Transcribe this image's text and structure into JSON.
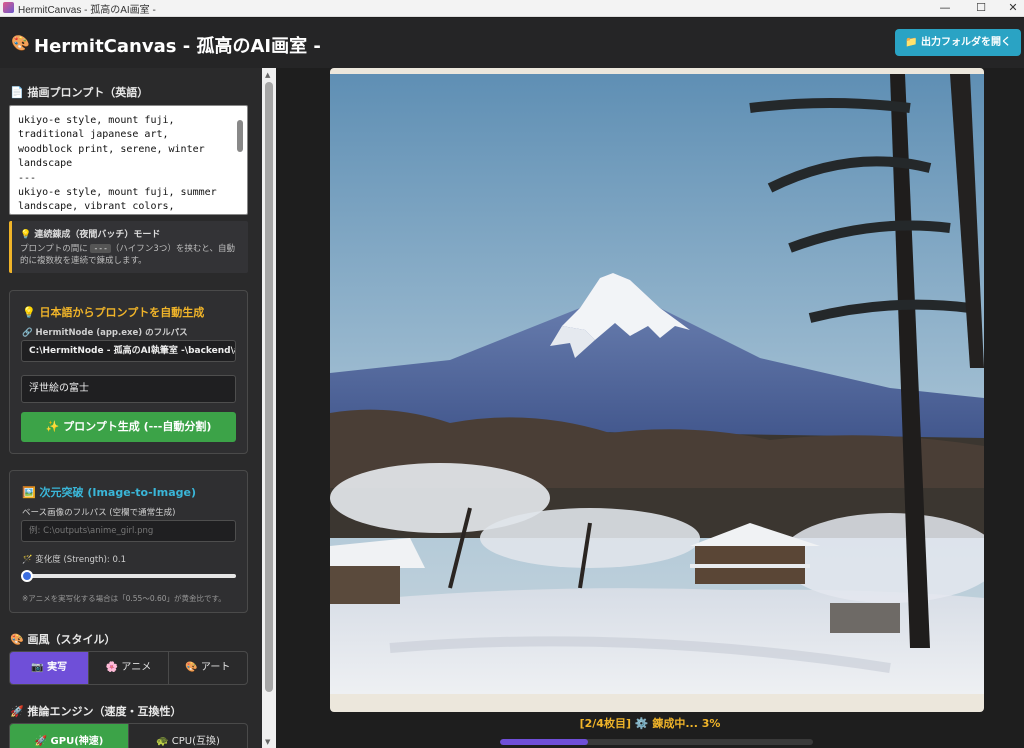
{
  "window": {
    "title": "HermitCanvas - 孤高のAI画室 -",
    "min": "—",
    "max": "☐",
    "close": "✕"
  },
  "header": {
    "icon": "🎨",
    "title": "HermitCanvas - 孤高のAI画室 -",
    "open_folder_label": "📁 出力フォルダを開く"
  },
  "prompt": {
    "label": "📄 描画プロンプト（英語）",
    "text": "ukiyo-e style, mount fuji, traditional japanese art, woodblock print, serene, winter landscape\n---\nukiyo-e style, mount fuji, summer landscape, vibrant colors, detailed trees"
  },
  "tip": {
    "title": "💡 連続錬成（夜間バッチ）モード",
    "body_before": "プロンプトの間に ",
    "code": "---",
    "body_after": "（ハイフン3つ）を挟むと、自動的に複数枚を連続で錬成します。"
  },
  "autogen": {
    "title": "💡 日本語からプロンプトを自動生成",
    "path_label": "🔗 HermitNode (app.exe) のフルパス",
    "path_value": "C:\\HermitNode - 孤高のAI執筆室 -\\backend\\app.exe",
    "jp_input_value": "浮世絵の富士",
    "button_label": "✨ プロンプト生成 (---自動分割)"
  },
  "img2img": {
    "title": "🖼️ 次元突破 (Image-to-Image)",
    "base_label": "ベース画像のフルパス (空欄で通常生成)",
    "base_placeholder": "例: C:\\outputs\\anime_girl.png",
    "strength_label": "🪄 変化度 (Strength): 0.1",
    "strength_value": 0.1,
    "note": "※アニメを実写化する場合は「0.55〜0.60」が黄金比です。"
  },
  "style": {
    "label": "🎨 画風（スタイル）",
    "options": [
      "📷 実写",
      "🌸 アニメ",
      "🎨 アート"
    ],
    "selected": 0
  },
  "engine": {
    "label": "🚀 推論エンジン（速度・互換性）",
    "options": [
      "🚀 GPU(神速)",
      "🐢 CPU(互換)"
    ],
    "selected": 0
  },
  "status": {
    "text": "[2/4枚目] ⚙️ 錬成中... 3%",
    "progress": 0.28
  },
  "colors": {
    "accent": "#6f4fd8",
    "success": "#3ca348",
    "info": "#2aa3c4",
    "warning": "#f0b429"
  }
}
